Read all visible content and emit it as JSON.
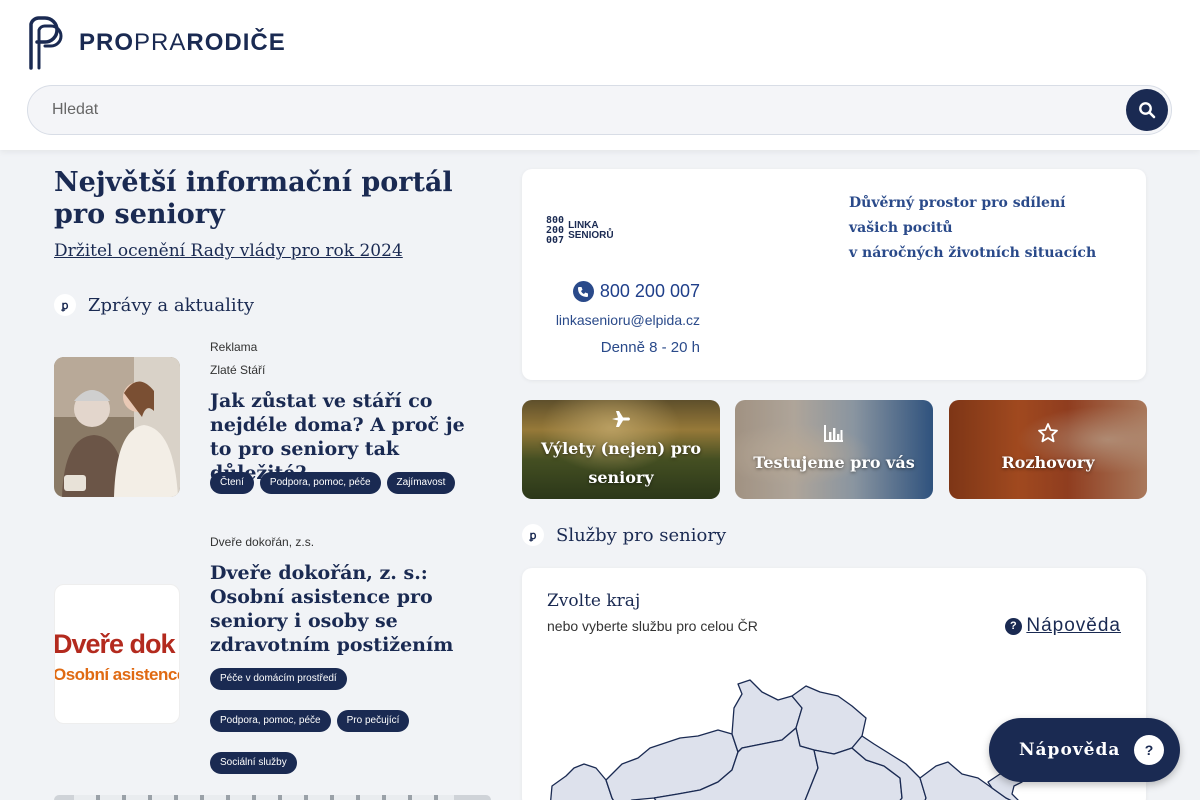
{
  "header": {
    "logo_bold": "PRO",
    "logo_thin": "PRA",
    "logo_end": "RODIČE",
    "search_placeholder": "Hledat"
  },
  "hero": {
    "title": "Největší informační portál pro seniory",
    "award_link": "Držitel ocenění Rady vlády pro rok 2024"
  },
  "news": {
    "section_title": "Zprávy a aktuality",
    "section_icon": "pp-logo-icon",
    "articles": [
      {
        "label": "Reklama",
        "source": "Zlaté Stáří",
        "title": "Jak zůstat ve stáří co nejdéle doma? A proč je to pro seniory tak důležité?",
        "tags": [
          "Čtení",
          "Podpora, pomoc, péče",
          "Zajímavost"
        ]
      },
      {
        "source": "Dveře dokořán, z.s.",
        "title": "Dveře dokořán, z. s.: Osobní asistence pro seniory i osoby se zdravotním postižením",
        "thumb_line1": "Dveře dok",
        "thumb_line2": "Osobní asistence",
        "tags": [
          "Péče v domácím prostředí",
          "Podpora, pomoc, péče",
          "Pro pečující",
          "Sociální služby"
        ]
      }
    ]
  },
  "linka": {
    "logo_numbers": [
      "800",
      "200",
      "007"
    ],
    "logo_name_1": "LINKA",
    "logo_name_2": "SENIORŮ",
    "phone": "800 200 007",
    "email": "linkasenioru@elpida.cz",
    "hours": "Denně 8 - 20 h",
    "description_line1": "Důvěrný prostor pro sdílení vašich pocitů",
    "description_line2": "v náročných životních situacích"
  },
  "tiles": [
    {
      "label": "Výlety (nejen) pro seniory",
      "icon": "plane-icon"
    },
    {
      "label": "Testujeme pro vás",
      "icon": "bar-chart-icon"
    },
    {
      "label": "Rozhovory",
      "icon": "star-icon"
    }
  ],
  "services": {
    "section_title": "Služby pro seniory",
    "kraj_title": "Zvolte kraj",
    "kraj_subtitle": "nebo vyberte službu pro celou ČR",
    "help_link": "Nápověda"
  },
  "floating_help": {
    "label": "Nápověda",
    "icon": "question-icon"
  },
  "colors": {
    "brand_navy": "#1a2a52",
    "link_blue": "#2a4a8a",
    "background": "#f1f3f6",
    "map_fill": "#dde1ec"
  }
}
